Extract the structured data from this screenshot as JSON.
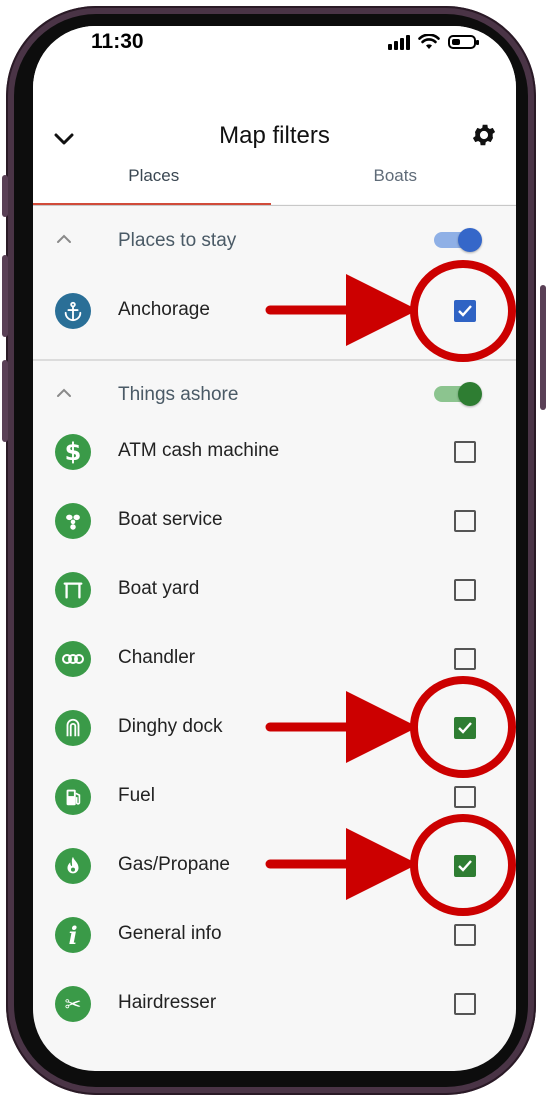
{
  "status": {
    "time": "11:30"
  },
  "header": {
    "title": "Map filters"
  },
  "tabs": [
    {
      "label": "Places",
      "active": true
    },
    {
      "label": "Boats",
      "active": false
    }
  ],
  "sections": [
    {
      "title": "Places to stay",
      "toggle_on": true,
      "toggle_color": "#3567c9",
      "items": [
        {
          "label": "Anchorage",
          "icon": "anchor-icon",
          "checked": true,
          "check_color": "#2f63c4"
        }
      ]
    },
    {
      "title": "Things ashore",
      "toggle_on": true,
      "toggle_color": "#2e7d32",
      "items": [
        {
          "label": "ATM cash machine",
          "icon": "dollar-icon",
          "checked": false
        },
        {
          "label": "Boat service",
          "icon": "propeller-icon",
          "checked": false
        },
        {
          "label": "Boat yard",
          "icon": "boat-yard-icon",
          "checked": false
        },
        {
          "label": "Chandler",
          "icon": "chandler-icon",
          "checked": false
        },
        {
          "label": "Dinghy dock",
          "icon": "dinghy-icon",
          "checked": true,
          "check_color": "#2e7d32"
        },
        {
          "label": "Fuel",
          "icon": "fuel-icon",
          "checked": false
        },
        {
          "label": "Gas/Propane",
          "icon": "flame-icon",
          "checked": true,
          "check_color": "#2e7d32"
        },
        {
          "label": "General info",
          "icon": "info-icon",
          "checked": false
        },
        {
          "label": "Hairdresser",
          "icon": "scissors-icon",
          "checked": false
        }
      ]
    }
  ],
  "colors": {
    "accent_tab": "#d14b3a",
    "places_icon_bg": "#2a6f97",
    "ashore_icon_bg": "#3a9a48",
    "annotation_red": "#cc0000"
  }
}
